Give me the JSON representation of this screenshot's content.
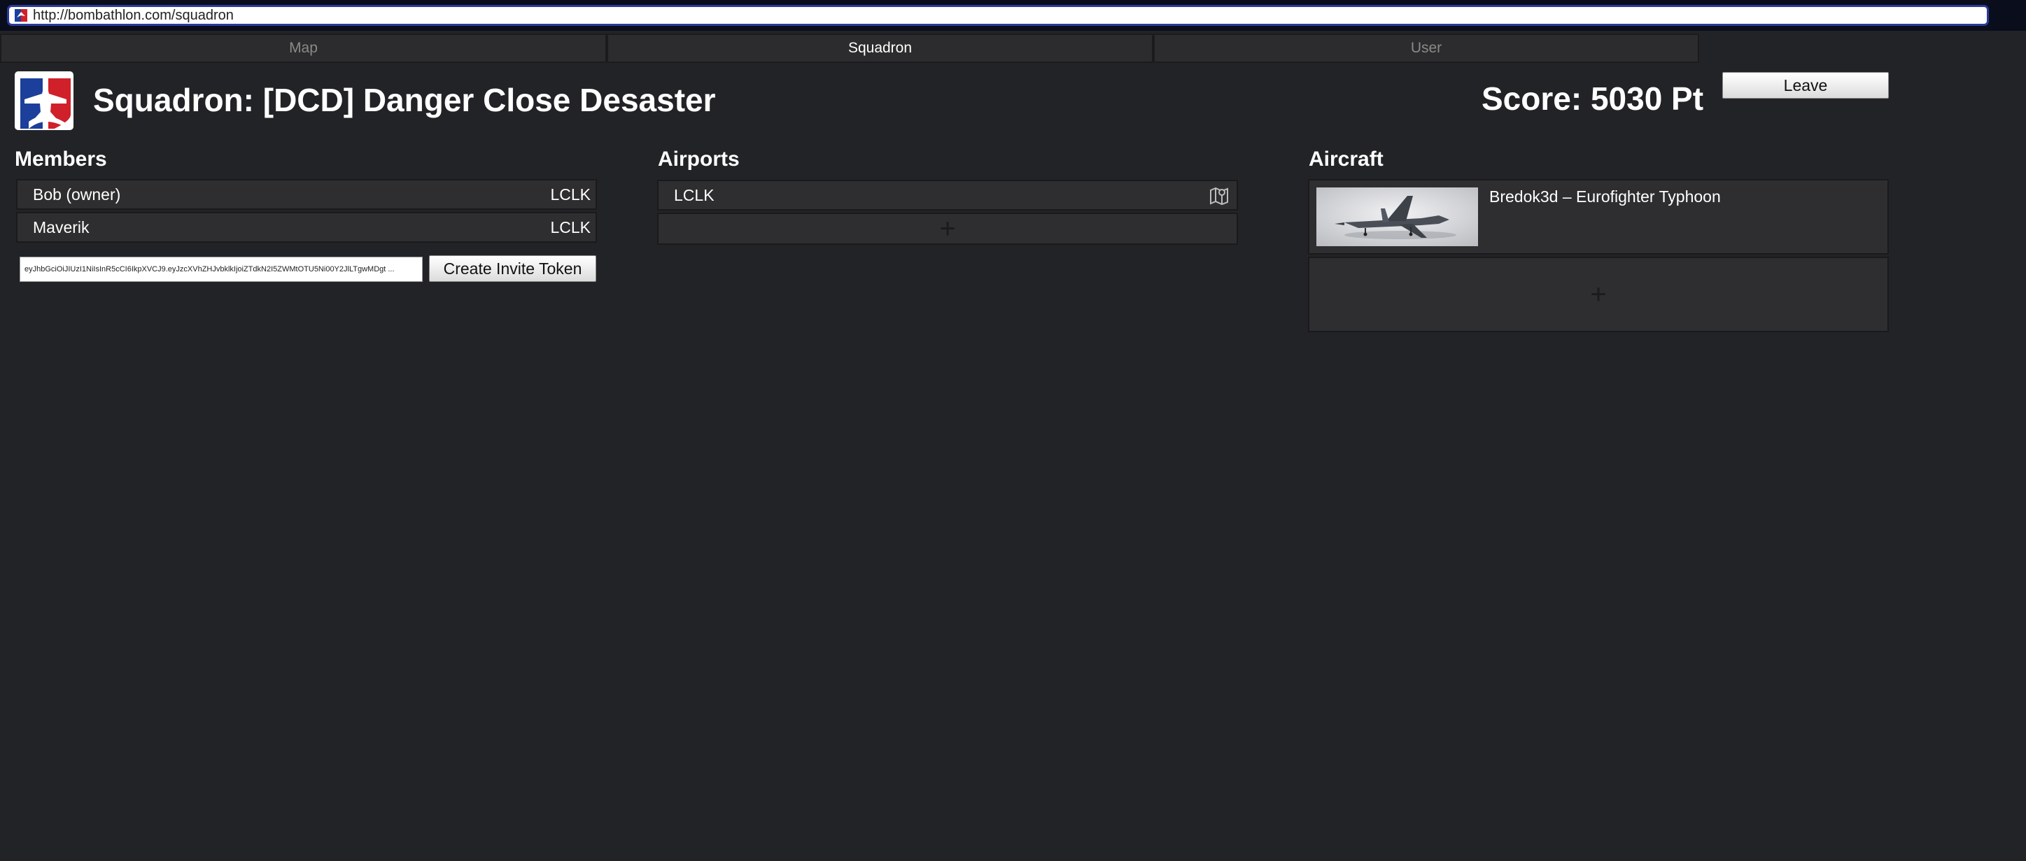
{
  "browser": {
    "url": "http://bombathlon.com/squadron"
  },
  "nav": {
    "tabs": [
      {
        "label": "Map"
      },
      {
        "label": "Squadron"
      },
      {
        "label": "User"
      }
    ]
  },
  "header": {
    "title": "Squadron: [DCD] Danger Close Desaster",
    "score": "Score: 5030 Pt",
    "leave_label": "Leave"
  },
  "members": {
    "heading": "Members",
    "rows": [
      {
        "name": "Bob (owner)",
        "airport": "LCLK"
      },
      {
        "name": "Maverik",
        "airport": "LCLK"
      }
    ],
    "token_value": "eyJhbGciOiJIUzI1NiIsInR5cCI6IkpXVCJ9.eyJzcXVhZHJvbklkIjoiZTdkN2I5ZWMtOTU5Ni00Y2JlLTgwMDgt ...",
    "create_token_label": "Create Invite Token"
  },
  "airports": {
    "heading": "Airports",
    "rows": [
      {
        "code": "LCLK",
        "icon": "map-icon"
      }
    ],
    "add_glyph": "+"
  },
  "aircraft": {
    "heading": "Aircraft",
    "items": [
      {
        "name": "Bredok3d – Eurofighter Typhoon"
      }
    ],
    "add_glyph": "+"
  },
  "colors": {
    "background": "#222326",
    "row": "#2e2e30",
    "tab": "#2c2c2e",
    "logo_blue": "#1c3f9c",
    "logo_red": "#d0202a"
  }
}
